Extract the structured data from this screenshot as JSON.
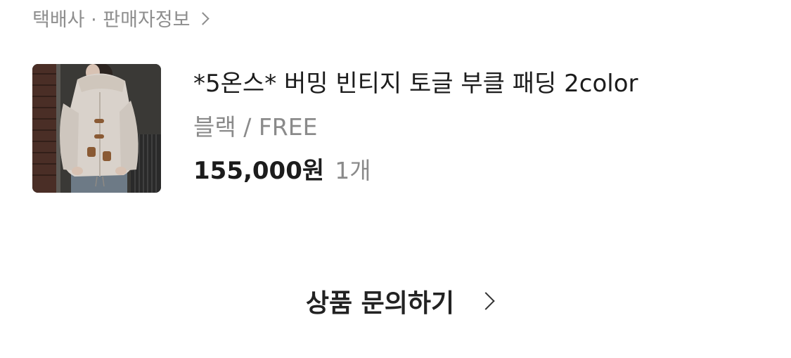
{
  "seller": {
    "label": "택배사 · 판매자정보",
    "icon": "chevron-right-icon"
  },
  "product": {
    "image_alt": "product-thumbnail",
    "title": "*5온스* 버밍 빈티지 토글 부클 패딩 2color",
    "option": "블랙 / FREE",
    "price": "155,000원",
    "quantity": "1개"
  },
  "inquiry": {
    "label": "상품 문의하기",
    "icon": "chevron-right-icon"
  },
  "colors": {
    "primary_text": "#1c1c1c",
    "secondary_text": "#8a8a8a",
    "background": "#ffffff"
  }
}
